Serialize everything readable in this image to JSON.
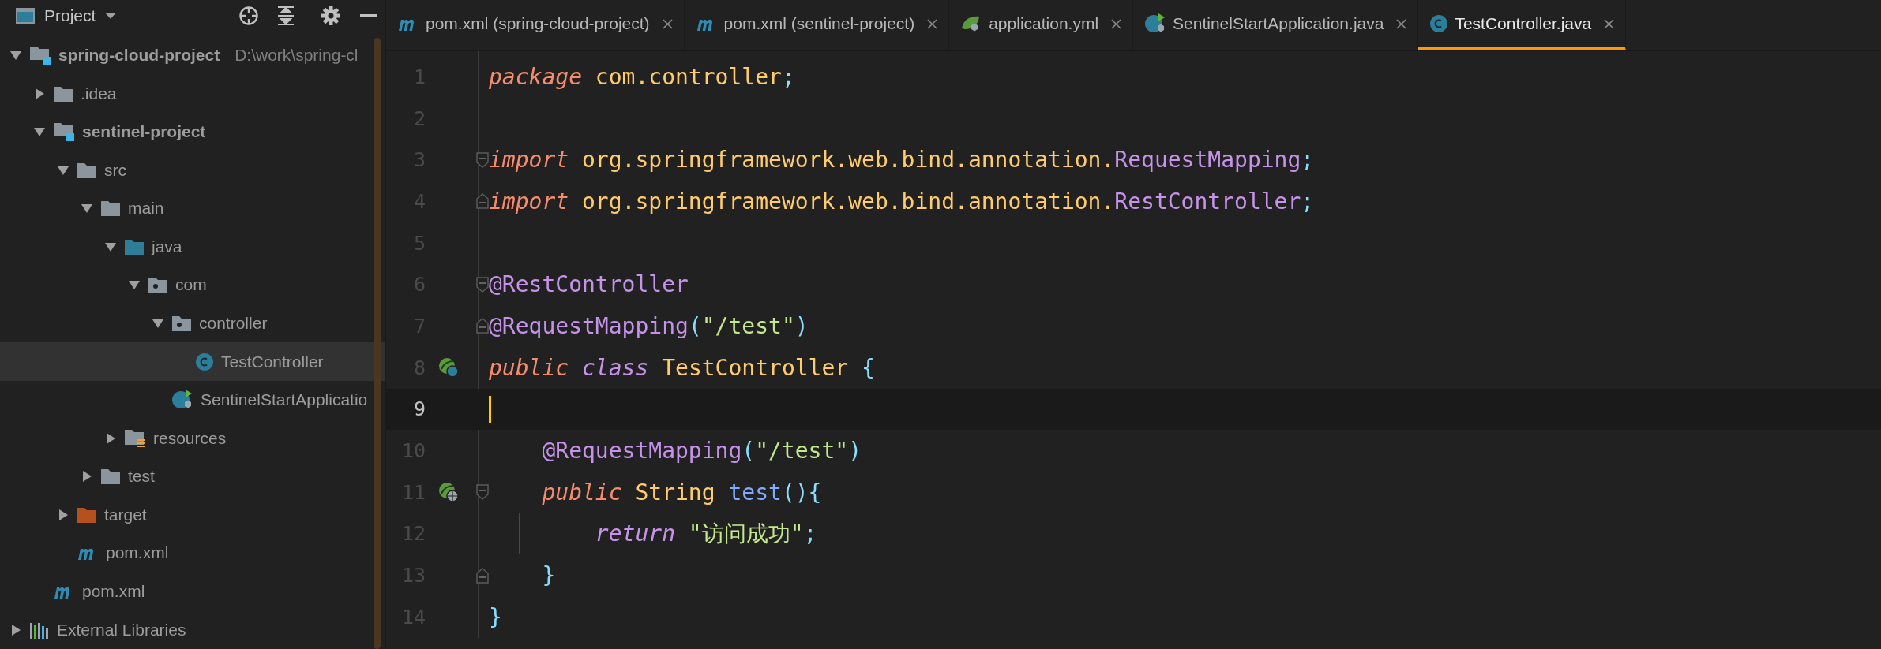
{
  "project_panel": {
    "title": "Project"
  },
  "tree": [
    {
      "label": "spring-cloud-project",
      "hint": "D:\\work\\spring-cl",
      "kind": "module",
      "expanded": true,
      "selected": false,
      "children": [
        {
          "label": ".idea",
          "kind": "folder",
          "expanded": false,
          "selected": false
        },
        {
          "label": "sentinel-project",
          "kind": "module",
          "expanded": true,
          "selected": false,
          "children": [
            {
              "label": "src",
              "kind": "folder",
              "expanded": true,
              "selected": false,
              "children": [
                {
                  "label": "main",
                  "kind": "folder",
                  "expanded": true,
                  "selected": false,
                  "children": [
                    {
                      "label": "java",
                      "kind": "source",
                      "expanded": true,
                      "selected": false,
                      "children": [
                        {
                          "label": "com",
                          "kind": "package",
                          "expanded": true,
                          "selected": false,
                          "children": [
                            {
                              "label": "controller",
                              "kind": "package",
                              "expanded": true,
                              "selected": false,
                              "children": [
                                {
                                  "label": "TestController",
                                  "kind": "class",
                                  "selected": true
                                }
                              ]
                            },
                            {
                              "label": "SentinelStartApplicatio",
                              "kind": "application",
                              "selected": false
                            }
                          ]
                        }
                      ]
                    },
                    {
                      "label": "resources",
                      "kind": "resources",
                      "expanded": false,
                      "selected": false
                    }
                  ]
                },
                {
                  "label": "test",
                  "kind": "folder",
                  "expanded": false,
                  "selected": false
                }
              ]
            },
            {
              "label": "target",
              "kind": "excluded",
              "expanded": false,
              "selected": false
            },
            {
              "label": "pom.xml",
              "kind": "maven",
              "selected": false
            }
          ]
        },
        {
          "label": "pom.xml",
          "kind": "maven",
          "selected": false
        }
      ]
    },
    {
      "label": "External Libraries",
      "kind": "libraries",
      "expanded": false,
      "selected": false
    }
  ],
  "tabs": [
    {
      "label": "pom.xml (spring-cloud-project)",
      "kind": "maven",
      "selected": false
    },
    {
      "label": "pom.xml (sentinel-project)",
      "kind": "maven",
      "selected": false
    },
    {
      "label": "application.yml",
      "kind": "config",
      "selected": false
    },
    {
      "label": "SentinelStartApplication.java",
      "kind": "application",
      "selected": false
    },
    {
      "label": "TestController.java",
      "kind": "class",
      "selected": true
    }
  ],
  "editor": {
    "lines": [
      {
        "number": "1",
        "current": false,
        "tokens": [
          {
            "text": "package",
            "kind": "keyword"
          },
          {
            "text": " com.controller",
            "kind": "type"
          },
          {
            "text": ";",
            "kind": "punct"
          }
        ]
      },
      {
        "number": "2",
        "current": false
      },
      {
        "number": "3",
        "current": false,
        "markers": [
          {
            "kind": "fold-start"
          }
        ],
        "tokens": [
          {
            "text": "import",
            "kind": "keyword"
          },
          {
            "text": " org.springframework.web.bind.annotation.",
            "kind": "type"
          },
          {
            "text": "RequestMapping",
            "kind": "annotation"
          },
          {
            "text": ";",
            "kind": "punct"
          }
        ]
      },
      {
        "number": "4",
        "current": false,
        "markers": [
          {
            "kind": "fold-end"
          }
        ],
        "tokens": [
          {
            "text": "import",
            "kind": "keyword"
          },
          {
            "text": " org.springframework.web.bind.annotation.",
            "kind": "type"
          },
          {
            "text": "RestController",
            "kind": "annotation"
          },
          {
            "text": ";",
            "kind": "punct"
          }
        ]
      },
      {
        "number": "5",
        "current": false
      },
      {
        "number": "6",
        "current": false,
        "markers": [
          {
            "kind": "fold-start"
          }
        ],
        "tokens": [
          {
            "text": "@RestController",
            "kind": "annotation"
          }
        ]
      },
      {
        "number": "7",
        "current": false,
        "markers": [
          {
            "kind": "fold-end"
          }
        ],
        "tokens": [
          {
            "text": "@RequestMapping",
            "kind": "annotation"
          },
          {
            "text": "(",
            "kind": "punct"
          },
          {
            "text": "\"/test\"",
            "kind": "string"
          },
          {
            "text": ")",
            "kind": "punct"
          }
        ]
      },
      {
        "number": "8",
        "current": false,
        "markers": [
          {
            "kind": "bean"
          }
        ],
        "tokens": [
          {
            "text": "public",
            "kind": "keyword"
          },
          {
            "text": " class",
            "kind": "keyword2"
          },
          {
            "text": " TestController ",
            "kind": "type"
          },
          {
            "text": "{",
            "kind": "punct"
          }
        ]
      },
      {
        "number": "9",
        "current": true
      },
      {
        "number": "10",
        "current": false,
        "tokens": [
          {
            "text": "    @RequestMapping",
            "kind": "annotation"
          },
          {
            "text": "(",
            "kind": "punct"
          },
          {
            "text": "\"/test\"",
            "kind": "string"
          },
          {
            "text": ")",
            "kind": "punct"
          }
        ]
      },
      {
        "number": "11",
        "current": false,
        "markers": [
          {
            "kind": "endpoint"
          },
          {
            "kind": "fold-start"
          }
        ],
        "tokens": [
          {
            "text": "    public",
            "kind": "keyword"
          },
          {
            "text": " String ",
            "kind": "type"
          },
          {
            "text": "test",
            "kind": "method"
          },
          {
            "text": "(){",
            "kind": "punct"
          }
        ]
      },
      {
        "number": "12",
        "current": false,
        "markers": [
          {
            "kind": "guide"
          }
        ],
        "tokens": [
          {
            "text": "        return",
            "kind": "keyword2"
          },
          {
            "text": " \"访问成功\"",
            "kind": "string"
          },
          {
            "text": ";",
            "kind": "punct"
          }
        ]
      },
      {
        "number": "13",
        "current": false,
        "markers": [
          {
            "kind": "fold-end"
          }
        ],
        "tokens": [
          {
            "text": "    }",
            "kind": "punct"
          }
        ]
      },
      {
        "number": "14",
        "current": false,
        "tokens": [
          {
            "text": "}",
            "kind": "punct"
          }
        ]
      }
    ]
  }
}
